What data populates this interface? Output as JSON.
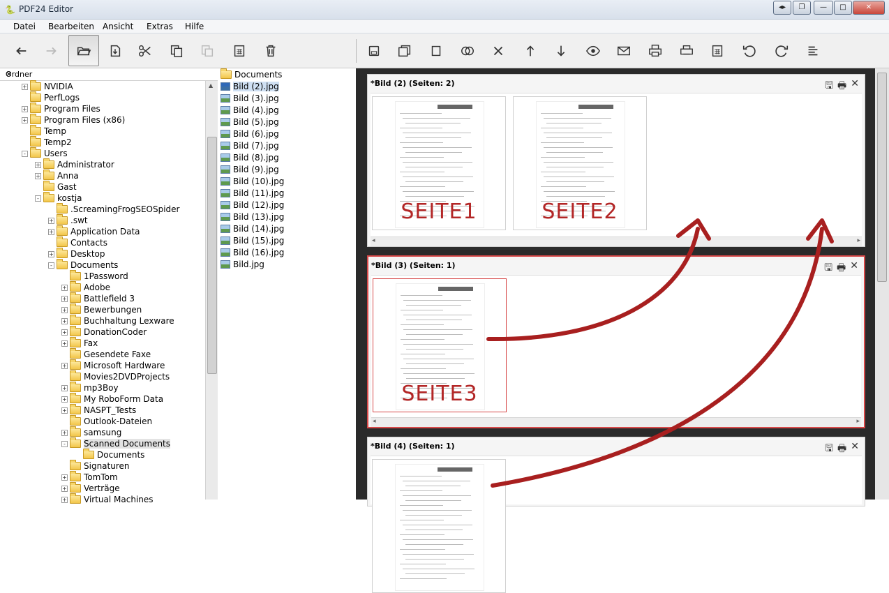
{
  "window": {
    "title": "PDF24 Editor",
    "controls": [
      "◂▸",
      "❐",
      "—",
      "□",
      "✕"
    ]
  },
  "menu": [
    "Datei",
    "Bearbeiten",
    "Ansicht",
    "Extras",
    "Hilfe"
  ],
  "toolbar_left": [
    "back-icon",
    "forward-icon",
    "open-folder-icon",
    "import-icon",
    "cut-icon",
    "copy-icon",
    "paste-icon",
    "calculator-icon",
    "trash-icon"
  ],
  "toolbar_right": [
    "save-icon",
    "save-as-icon",
    "new-document-icon",
    "merge-icon",
    "close-icon",
    "move-up-icon",
    "move-down-icon",
    "preview-icon",
    "email-icon",
    "print-icon",
    "printer-icon",
    "calculator-icon",
    "rotate-left-icon",
    "rotate-right-icon",
    "align-icon"
  ],
  "folder_panel": {
    "header": "Ordner",
    "close": "✕",
    "tree": [
      {
        "label": "NVIDIA",
        "level": 2,
        "exp": "+"
      },
      {
        "label": "PerfLogs",
        "level": 2,
        "exp": ""
      },
      {
        "label": "Program Files",
        "level": 2,
        "exp": "+"
      },
      {
        "label": "Program Files (x86)",
        "level": 2,
        "exp": "+"
      },
      {
        "label": "Temp",
        "level": 2,
        "exp": ""
      },
      {
        "label": "Temp2",
        "level": 2,
        "exp": ""
      },
      {
        "label": "Users",
        "level": 2,
        "exp": "-"
      },
      {
        "label": "Administrator",
        "level": 3,
        "exp": "+"
      },
      {
        "label": "Anna",
        "level": 3,
        "exp": "+"
      },
      {
        "label": "Gast",
        "level": 3,
        "exp": ""
      },
      {
        "label": "kostja",
        "level": 3,
        "exp": "-"
      },
      {
        "label": ".ScreamingFrogSEOSpider",
        "level": 4,
        "exp": ""
      },
      {
        "label": ".swt",
        "level": 4,
        "exp": "+"
      },
      {
        "label": "Application Data",
        "level": 4,
        "exp": "+"
      },
      {
        "label": "Contacts",
        "level": 4,
        "exp": ""
      },
      {
        "label": "Desktop",
        "level": 4,
        "exp": "+"
      },
      {
        "label": "Documents",
        "level": 4,
        "exp": "-"
      },
      {
        "label": "1Password",
        "level": 5,
        "exp": ""
      },
      {
        "label": "Adobe",
        "level": 5,
        "exp": "+"
      },
      {
        "label": "Battlefield 3",
        "level": 5,
        "exp": "+"
      },
      {
        "label": "Bewerbungen",
        "level": 5,
        "exp": "+"
      },
      {
        "label": "Buchhaltung Lexware",
        "level": 5,
        "exp": "+"
      },
      {
        "label": "DonationCoder",
        "level": 5,
        "exp": "+"
      },
      {
        "label": "Fax",
        "level": 5,
        "exp": "+"
      },
      {
        "label": "Gesendete Faxe",
        "level": 5,
        "exp": ""
      },
      {
        "label": "Microsoft Hardware",
        "level": 5,
        "exp": "+"
      },
      {
        "label": "Movies2DVDProjects",
        "level": 5,
        "exp": ""
      },
      {
        "label": "mp3Boy",
        "level": 5,
        "exp": "+"
      },
      {
        "label": "My RoboForm Data",
        "level": 5,
        "exp": "+"
      },
      {
        "label": "NASPT_Tests",
        "level": 5,
        "exp": "+"
      },
      {
        "label": "Outlook-Dateien",
        "level": 5,
        "exp": ""
      },
      {
        "label": "samsung",
        "level": 5,
        "exp": "+"
      },
      {
        "label": "Scanned Documents",
        "level": 5,
        "exp": "-",
        "selected": true
      },
      {
        "label": "Documents",
        "level": 6,
        "exp": ""
      },
      {
        "label": "Signaturen",
        "level": 5,
        "exp": ""
      },
      {
        "label": "TomTom",
        "level": 5,
        "exp": "+"
      },
      {
        "label": "Verträge",
        "level": 5,
        "exp": "+"
      },
      {
        "label": "Virtual Machines",
        "level": 5,
        "exp": "+"
      }
    ]
  },
  "file_panel": {
    "items": [
      {
        "label": "Documents",
        "type": "folder"
      },
      {
        "label": "Bild (2).jpg",
        "type": "image",
        "selected": true
      },
      {
        "label": "Bild (3).jpg",
        "type": "image"
      },
      {
        "label": "Bild (4).jpg",
        "type": "image"
      },
      {
        "label": "Bild (5).jpg",
        "type": "image"
      },
      {
        "label": "Bild (6).jpg",
        "type": "image"
      },
      {
        "label": "Bild (7).jpg",
        "type": "image"
      },
      {
        "label": "Bild (8).jpg",
        "type": "image"
      },
      {
        "label": "Bild (9).jpg",
        "type": "image"
      },
      {
        "label": "Bild (10).jpg",
        "type": "image"
      },
      {
        "label": "Bild (11).jpg",
        "type": "image"
      },
      {
        "label": "Bild (12).jpg",
        "type": "image"
      },
      {
        "label": "Bild (13).jpg",
        "type": "image"
      },
      {
        "label": "Bild (14).jpg",
        "type": "image"
      },
      {
        "label": "Bild (15).jpg",
        "type": "image"
      },
      {
        "label": "Bild (16).jpg",
        "type": "image"
      },
      {
        "label": "Bild.jpg",
        "type": "image"
      }
    ]
  },
  "documents": [
    {
      "title": "*Bild (2) (Seiten: 2)",
      "pages": [
        "SEITE1",
        "SEITE2"
      ],
      "active": false
    },
    {
      "title": "*Bild (3) (Seiten: 1)",
      "pages": [
        "SEITE3"
      ],
      "active": true
    },
    {
      "title": "*Bild (4) (Seiten: 1)",
      "pages": [
        ""
      ],
      "active": false
    }
  ],
  "colors": {
    "accent_red": "#b32626",
    "active_border": "#d74848",
    "doc_area_bg": "#2a2a2a"
  }
}
